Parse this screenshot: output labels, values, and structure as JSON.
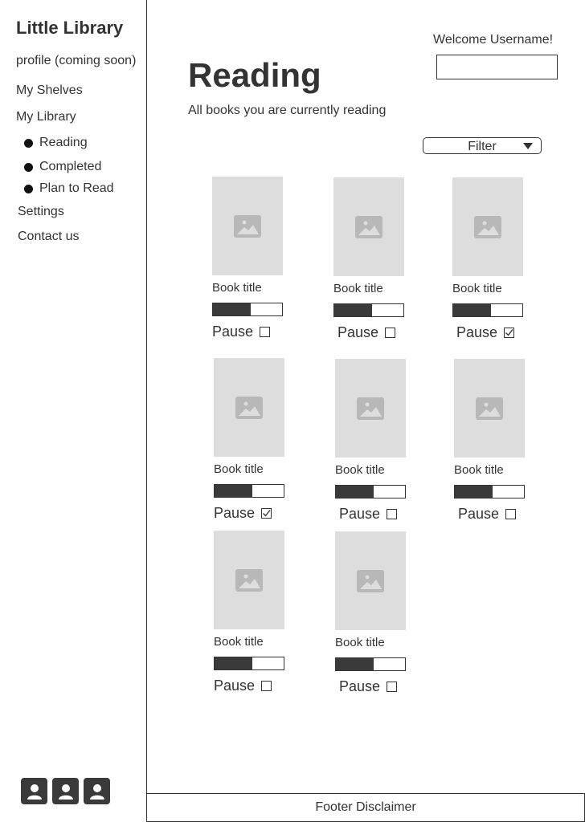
{
  "sidebar": {
    "app_title": "Little Library",
    "items": [
      {
        "label": "profile (coming soon)"
      },
      {
        "label": "My Shelves"
      },
      {
        "label": "My Library"
      }
    ],
    "sub_items": [
      {
        "label": "Reading"
      },
      {
        "label": "Completed"
      },
      {
        "label": "Plan to Read"
      }
    ],
    "bottom_items": [
      {
        "label": "Settings"
      },
      {
        "label": "Contact us"
      }
    ],
    "avatar_icons": [
      "user-avatar-icon",
      "user-avatar-icon",
      "user-avatar-icon"
    ]
  },
  "header": {
    "welcome_text": "Welcome Username!",
    "user_input_value": ""
  },
  "main": {
    "title": "Reading",
    "subtitle": "All books you are currently reading",
    "filter_label": "Filter"
  },
  "books": [
    {
      "title": "Book title",
      "progress": 0.55,
      "pause_label": "Pause",
      "paused": false
    },
    {
      "title": "Book title",
      "progress": 0.55,
      "pause_label": "Pause",
      "paused": false
    },
    {
      "title": "Book title",
      "progress": 0.55,
      "pause_label": "Pause",
      "paused": true
    },
    {
      "title": "Book title",
      "progress": 0.55,
      "pause_label": "Pause",
      "paused": true
    },
    {
      "title": "Book title",
      "progress": 0.55,
      "pause_label": "Pause",
      "paused": false
    },
    {
      "title": "Book title",
      "progress": 0.55,
      "pause_label": "Pause",
      "paused": false
    },
    {
      "title": "Book title",
      "progress": 0.55,
      "pause_label": "Pause",
      "paused": false
    },
    {
      "title": "Book title",
      "progress": 0.55,
      "pause_label": "Pause",
      "paused": false
    }
  ],
  "footer": {
    "text": "Footer Disclaimer"
  },
  "colors": {
    "text": "#333333",
    "cover_placeholder": "#dddddd",
    "progress_fill": "#3a3a3a"
  }
}
